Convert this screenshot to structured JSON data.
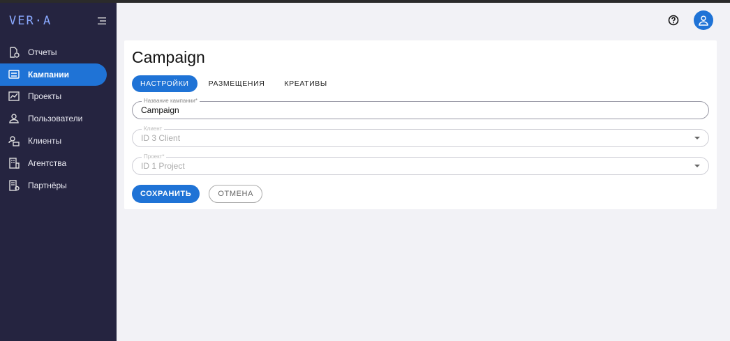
{
  "brand": {
    "logo": "VER·A"
  },
  "sidebar": {
    "items": [
      {
        "label": "Отчеты",
        "icon": "report-icon",
        "active": false
      },
      {
        "label": "Кампании",
        "icon": "campaign-icon",
        "active": true
      },
      {
        "label": "Проекты",
        "icon": "chart-icon",
        "active": false
      },
      {
        "label": "Пользователи",
        "icon": "user-icon",
        "active": false
      },
      {
        "label": "Клиенты",
        "icon": "client-icon",
        "active": false
      },
      {
        "label": "Агентства",
        "icon": "agency-icon",
        "active": false
      },
      {
        "label": "Партнёры",
        "icon": "partner-icon",
        "active": false
      }
    ]
  },
  "page": {
    "title": "Campaign"
  },
  "tabs": [
    {
      "label": "НАСТРОЙКИ",
      "active": true
    },
    {
      "label": "РАЗМЕЩЕНИЯ",
      "active": false
    },
    {
      "label": "КРЕАТИВЫ",
      "active": false
    }
  ],
  "form": {
    "name": {
      "label": "Название кампании*",
      "value": "Campaign"
    },
    "client": {
      "label": "Клиент",
      "value": "ID 3 Client"
    },
    "project": {
      "label": "Проект*",
      "value": "ID 1 Project"
    }
  },
  "actions": {
    "save": "СОХРАНИТЬ",
    "cancel": "ОТМЕНА"
  },
  "colors": {
    "accent": "#1f73d6",
    "sidebar_bg": "#252440",
    "logo": "#8aa9ff"
  }
}
